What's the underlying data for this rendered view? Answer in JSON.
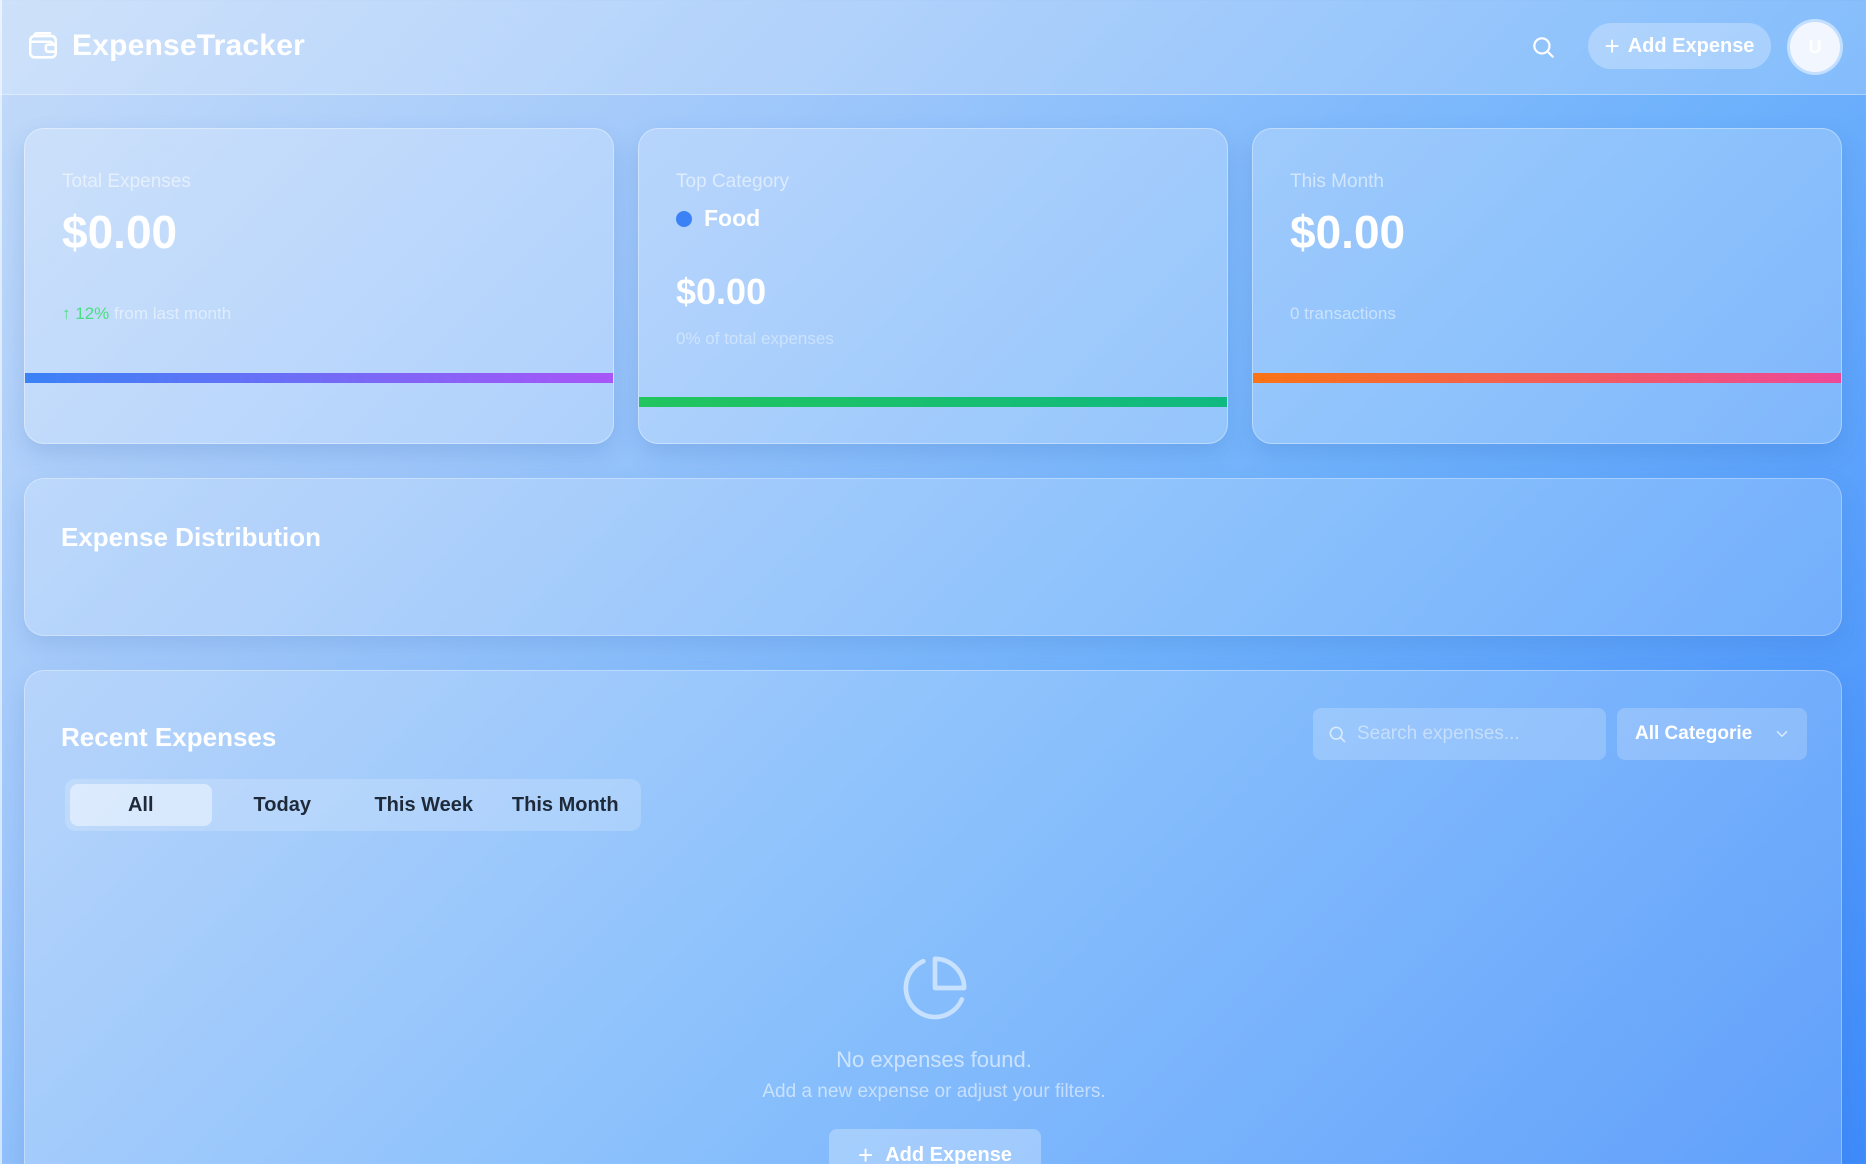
{
  "header": {
    "app_name": "ExpenseTracker",
    "brand_icon": "wallet-icon",
    "search_icon": "search-icon",
    "add_button_label": "Add Expense",
    "avatar_initial": "U"
  },
  "stats": {
    "total": {
      "label": "Total Expenses",
      "value": "$0.00",
      "trend_arrow": "↑",
      "trend_pct": "12%",
      "trend_text": "from last month",
      "accent_gradient": [
        "#3b82f6",
        "#a855f7"
      ]
    },
    "top_category": {
      "label": "Top Category",
      "category": "Food",
      "category_color": "#3b82f6",
      "value": "$0.00",
      "share_text": "0% of total expenses",
      "accent_gradient": [
        "#22c55e",
        "#10b981"
      ]
    },
    "month": {
      "label": "This Month",
      "value": "$0.00",
      "transactions_text": "0 transactions",
      "accent_gradient": [
        "#f97316",
        "#ec4899"
      ]
    }
  },
  "distribution": {
    "title": "Expense Distribution"
  },
  "recent": {
    "title": "Recent Expenses",
    "search_placeholder": "Search expenses...",
    "category_select": "All Categories",
    "tabs": [
      "All",
      "Today",
      "This Week",
      "This Month"
    ],
    "active_tab": "All",
    "empty_icon": "pie-chart-icon",
    "empty_title": "No expenses found.",
    "empty_subtitle": "Add a new expense or adjust your filters.",
    "empty_button_label": "Add Expense"
  }
}
